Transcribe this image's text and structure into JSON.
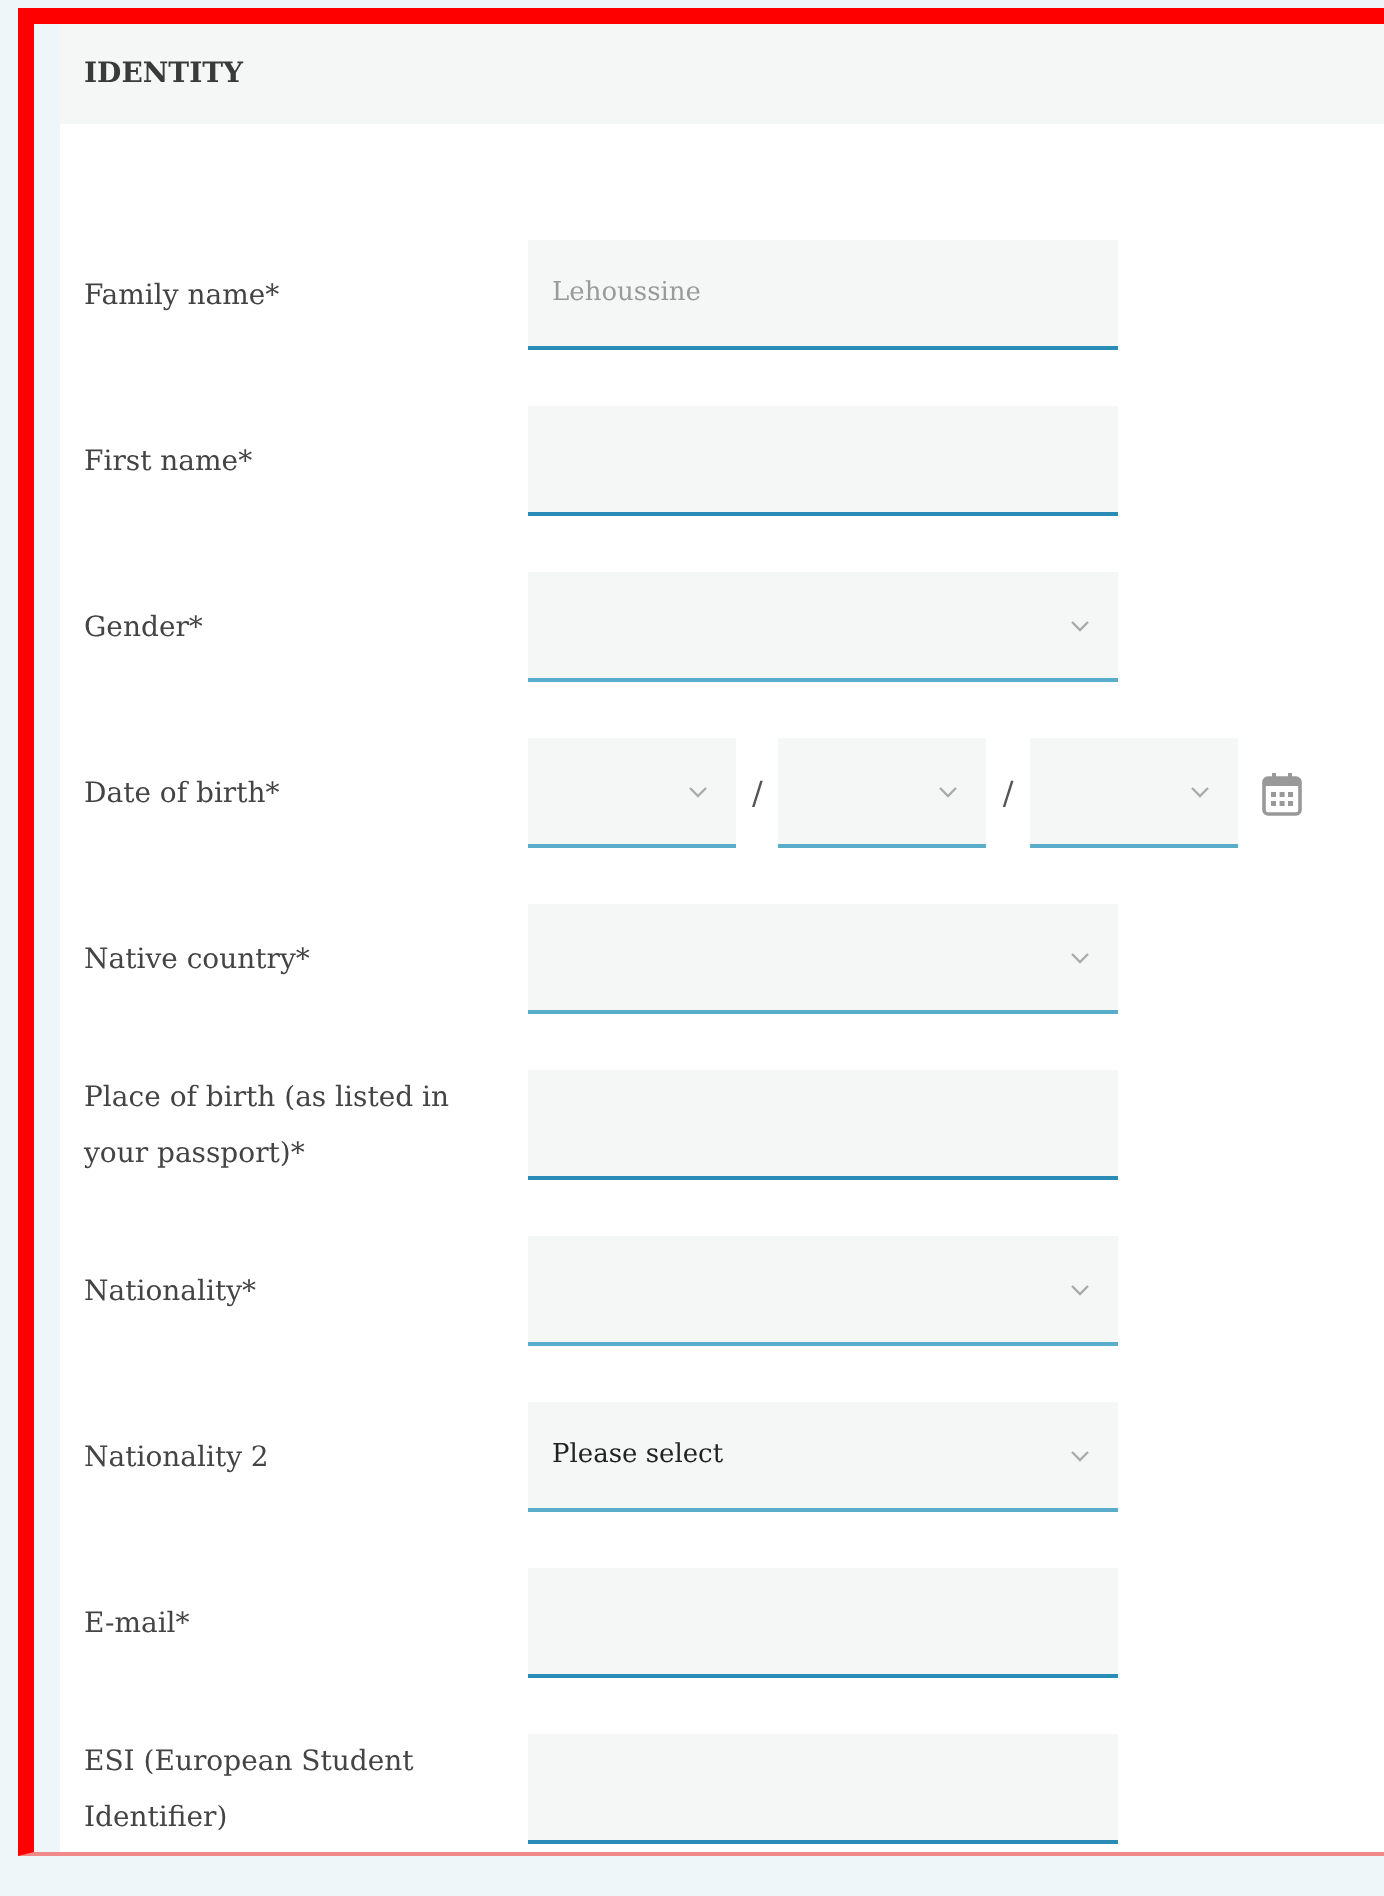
{
  "section": {
    "title": "IDENTITY"
  },
  "fields": [
    {
      "label": "Family name*",
      "kind": "text",
      "placeholder": "Lehoussine"
    },
    {
      "label": "First name*",
      "kind": "text"
    },
    {
      "label": "Gender*",
      "kind": "select"
    },
    {
      "label": "Date of birth*",
      "kind": "date",
      "separators": [
        "/",
        "/"
      ]
    },
    {
      "label": "Native country*",
      "kind": "select"
    },
    {
      "label": "Place of birth (as listed in your passport)*",
      "kind": "text"
    },
    {
      "label": "Nationality*",
      "kind": "select"
    },
    {
      "label": "Nationality 2",
      "kind": "select",
      "value": "Please select"
    },
    {
      "label": "E-mail*",
      "kind": "text"
    },
    {
      "label": "ESI (European Student Identifier)",
      "kind": "text"
    }
  ]
}
